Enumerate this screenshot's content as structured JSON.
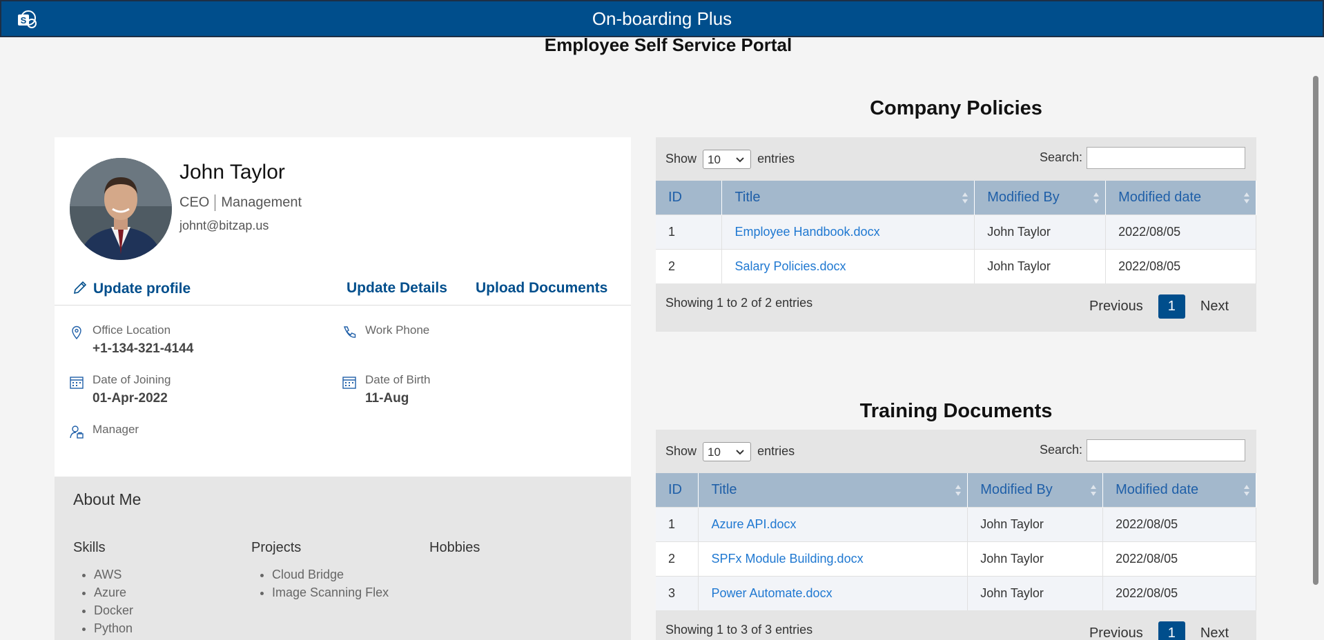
{
  "app": {
    "title": "On-boarding Plus",
    "logo_icon": "sharepoint-logo-icon"
  },
  "page": {
    "title": "Employee Self Service Portal"
  },
  "profile": {
    "name": "John Taylor",
    "role": "CEO",
    "department": "Management",
    "email": "johnt@bitzap.us",
    "actions": {
      "update_profile": "Update profile",
      "update_details": "Update Details",
      "upload_documents": "Upload Documents"
    },
    "fields": {
      "office_location": {
        "label": "Office Location",
        "value": "+1-134-321-4144"
      },
      "work_phone": {
        "label": "Work Phone",
        "value": ""
      },
      "date_of_joining": {
        "label": "Date of Joining",
        "value": "01-Apr-2022"
      },
      "date_of_birth": {
        "label": "Date of Birth",
        "value": "11-Aug"
      },
      "manager": {
        "label": "Manager",
        "value": ""
      }
    }
  },
  "about": {
    "title": "About Me",
    "skills": {
      "heading": "Skills",
      "items": [
        "AWS",
        "Azure",
        "Docker",
        "Python"
      ]
    },
    "projects": {
      "heading": "Projects",
      "items": [
        "Cloud Bridge",
        "Image Scanning Flex"
      ]
    },
    "hobbies": {
      "heading": "Hobbies",
      "items": []
    }
  },
  "policies": {
    "title": "Company Policies",
    "show_label": "Show",
    "entries_value": "10",
    "entries_label": "entries",
    "search_label": "Search:",
    "columns": [
      "ID",
      "Title",
      "Modified By",
      "Modified date"
    ],
    "rows": [
      {
        "id": "1",
        "title": "Employee Handbook.docx",
        "modified_by": "John Taylor",
        "modified_date": "2022/08/05"
      },
      {
        "id": "2",
        "title": "Salary Policies.docx",
        "modified_by": "John Taylor",
        "modified_date": "2022/08/05"
      }
    ],
    "info": "Showing 1 to 2 of 2 entries",
    "pager": {
      "previous": "Previous",
      "current": "1",
      "next": "Next"
    }
  },
  "training": {
    "title": "Training Documents",
    "show_label": "Show",
    "entries_value": "10",
    "entries_label": "entries",
    "search_label": "Search:",
    "columns": [
      "ID",
      "Title",
      "Modified By",
      "Modified date"
    ],
    "rows": [
      {
        "id": "1",
        "title": "Azure API.docx",
        "modified_by": "John Taylor",
        "modified_date": "2022/08/05"
      },
      {
        "id": "2",
        "title": "SPFx Module Building.docx",
        "modified_by": "John Taylor",
        "modified_date": "2022/08/05"
      },
      {
        "id": "3",
        "title": "Power Automate.docx",
        "modified_by": "John Taylor",
        "modified_date": "2022/08/05"
      }
    ],
    "info": "Showing 1 to 3 of 3 entries",
    "pager": {
      "previous": "Previous",
      "current": "1",
      "next": "Next"
    }
  },
  "colors": {
    "brand": "#004e8c",
    "header_row": "#a3b8cc",
    "link": "#1f78d1"
  }
}
